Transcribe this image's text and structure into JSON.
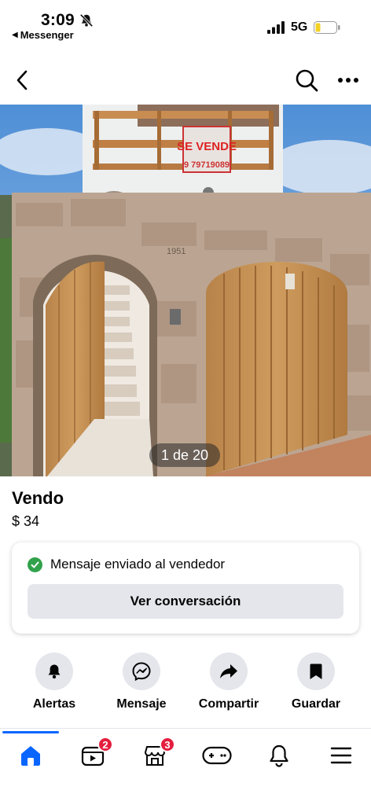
{
  "status_bar": {
    "time": "3:09",
    "back_app": "Messenger",
    "network": "5G"
  },
  "listing": {
    "photo_counter": "1 de 20",
    "sign_line1": "SE VENDE",
    "sign_line2": "9 79719089",
    "house_number": "1951",
    "title": "Vendo",
    "price": "$ 34"
  },
  "message": {
    "status": "Mensaje enviado al vendedor",
    "button_label": "Ver conversación"
  },
  "actions": [
    {
      "label": "Alertas",
      "icon": "bell-icon"
    },
    {
      "label": "Mensaje",
      "icon": "messenger-icon"
    },
    {
      "label": "Compartir",
      "icon": "share-icon"
    },
    {
      "label": "Guardar",
      "icon": "bookmark-icon"
    }
  ],
  "tabs": [
    {
      "icon": "home-icon",
      "active": true
    },
    {
      "icon": "video-icon",
      "badge": "2"
    },
    {
      "icon": "marketplace-icon",
      "badge": "3"
    },
    {
      "icon": "gaming-icon"
    },
    {
      "icon": "notifications-icon"
    },
    {
      "icon": "menu-icon"
    }
  ],
  "colors": {
    "accent": "#0866ff",
    "success": "#31a24c",
    "badge": "#e41e3f",
    "button_bg": "#e4e6eb"
  }
}
